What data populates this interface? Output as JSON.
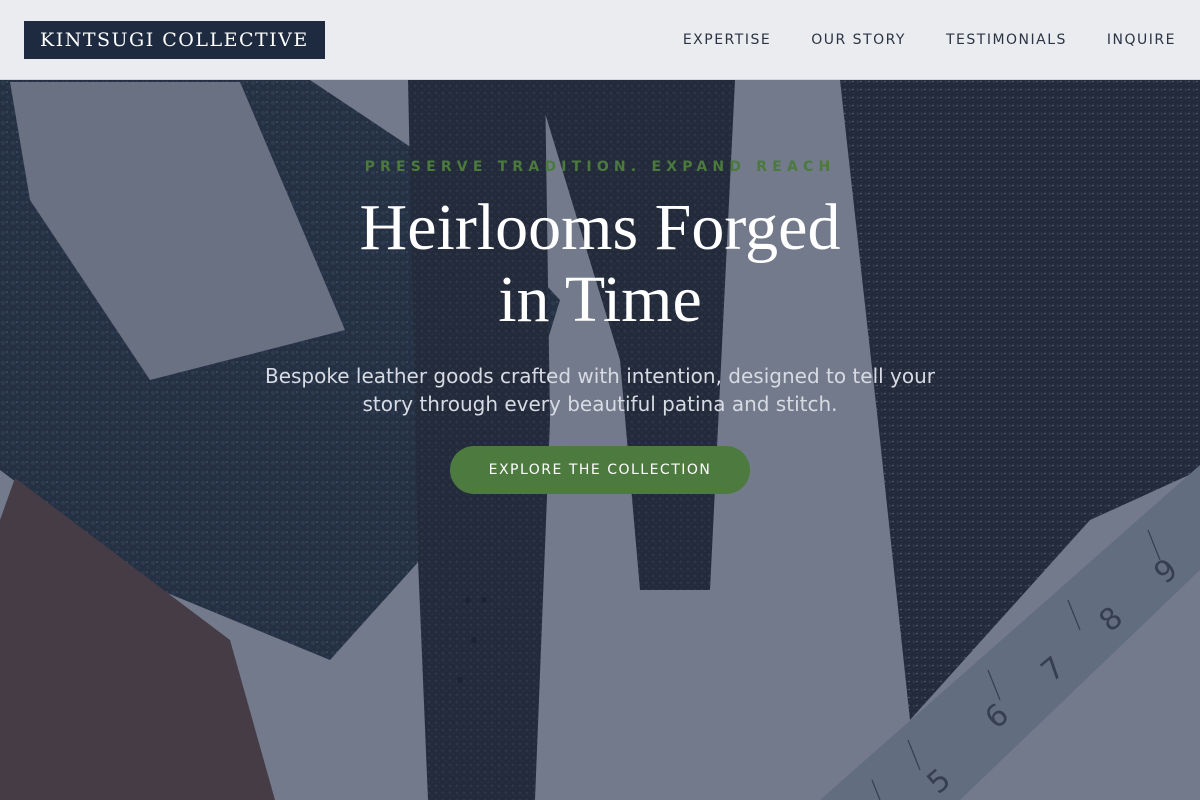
{
  "header": {
    "logo": "KINTSUGI COLLECTIVE",
    "nav": [
      {
        "label": "EXPERTISE"
      },
      {
        "label": "OUR STORY"
      },
      {
        "label": "TESTIMONIALS"
      },
      {
        "label": "INQUIRE"
      }
    ]
  },
  "hero": {
    "eyebrow": "PRESERVE TRADITION. EXPAND REACH",
    "title_lines": [
      "Heirlooms Forged",
      "in Time"
    ],
    "subtitle_lines": [
      "Bespoke leather goods crafted with intention, designed to tell your",
      "story through every beautiful patina and stitch."
    ],
    "cta_label": "EXPLORE THE COLLECTION",
    "ruler_numbers": [
      "5",
      "6",
      "7",
      "8",
      "9"
    ]
  },
  "colors": {
    "accent": "#4c7a3f",
    "logo_bg": "#1e2a40",
    "header_bg": "#ebecef"
  }
}
